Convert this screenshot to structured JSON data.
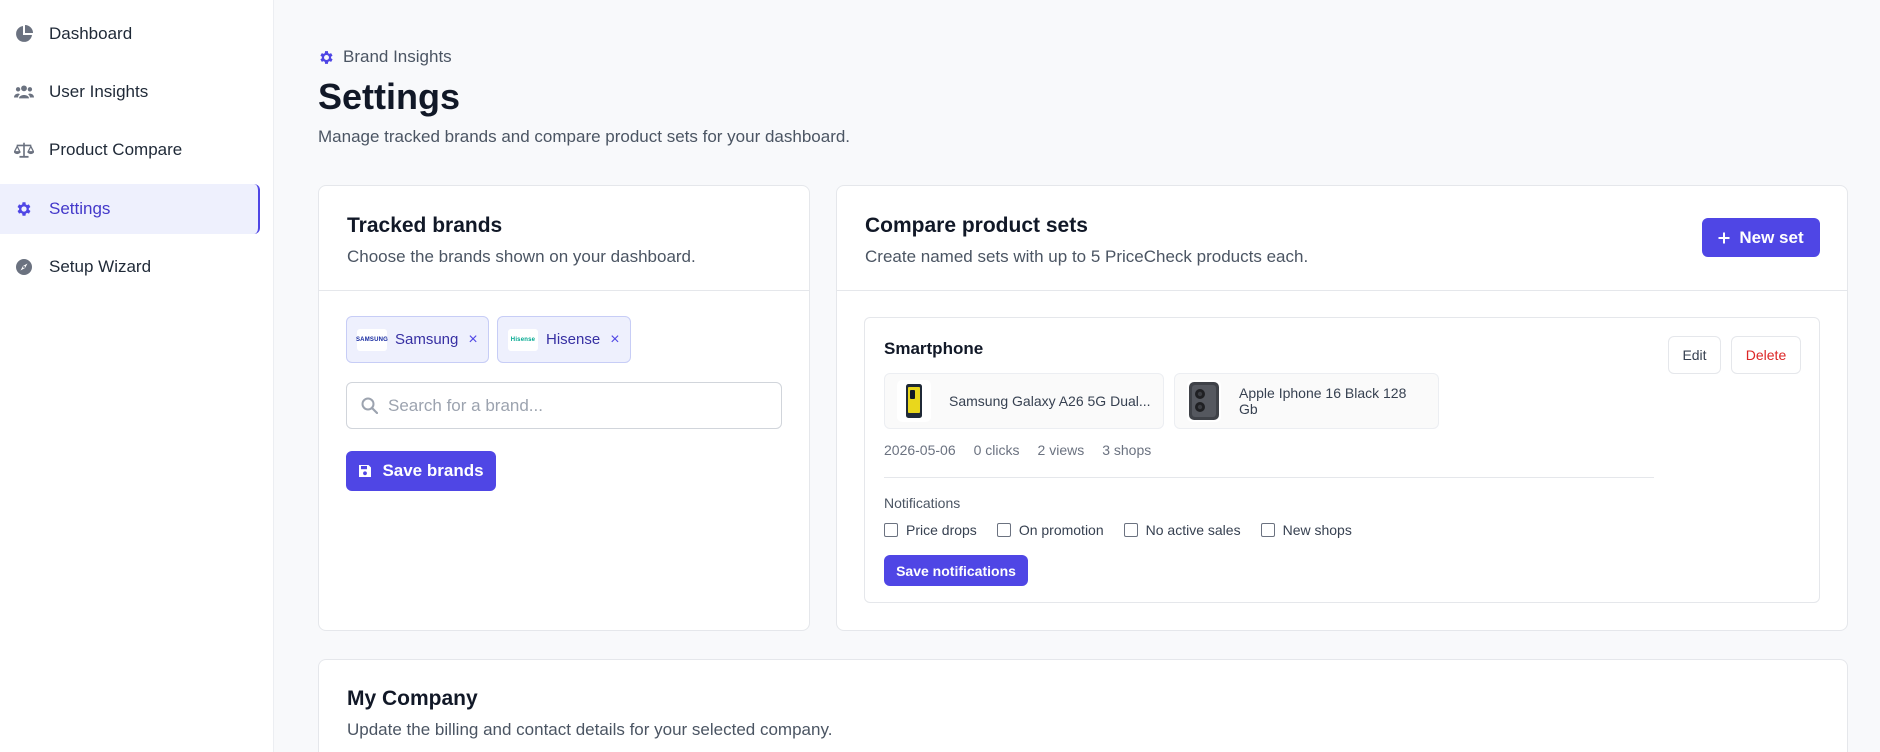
{
  "sidebar": {
    "items": [
      {
        "label": "Dashboard",
        "icon": "pie-chart-icon"
      },
      {
        "label": "User Insights",
        "icon": "users-icon"
      },
      {
        "label": "Product Compare",
        "icon": "scale-icon"
      },
      {
        "label": "Settings",
        "icon": "gear-icon",
        "active": true
      },
      {
        "label": "Setup Wizard",
        "icon": "compass-icon"
      }
    ]
  },
  "header": {
    "breadcrumb": "Brand Insights",
    "title": "Settings",
    "subtitle": "Manage tracked brands and compare product sets for your dashboard."
  },
  "tracked_brands": {
    "title": "Tracked brands",
    "subtitle": "Choose the brands shown on your dashboard.",
    "chips": [
      {
        "name": "Samsung",
        "logo_text": "SAMSUNG",
        "logo_color": "#1428a0"
      },
      {
        "name": "Hisense",
        "logo_text": "Hisense",
        "logo_color": "#00a88f"
      }
    ],
    "remove_glyph": "×",
    "search_placeholder": "Search for a brand...",
    "save_label": "Save brands"
  },
  "compare_sets": {
    "title": "Compare product sets",
    "subtitle": "Create named sets with up to 5 PriceCheck products each.",
    "new_set_label": "New set",
    "sets": [
      {
        "name": "Smartphone",
        "edit_label": "Edit",
        "delete_label": "Delete",
        "products": [
          {
            "name": "Samsung Galaxy A26 5G Dual..."
          },
          {
            "name": "Apple Iphone 16 Black 128 Gb"
          }
        ],
        "stats": {
          "date": "2026-05-06",
          "clicks": "0 clicks",
          "views": "2 views",
          "shops": "3 shops"
        },
        "notifications_label": "Notifications",
        "notifications": [
          "Price drops",
          "On promotion",
          "No active sales",
          "New shops"
        ],
        "save_notifications_label": "Save notifications"
      }
    ]
  },
  "company": {
    "title": "My Company",
    "subtitle": "Update the billing and contact details for your selected company."
  },
  "colors": {
    "accent": "#4f46e5",
    "delete": "#dc2626"
  }
}
